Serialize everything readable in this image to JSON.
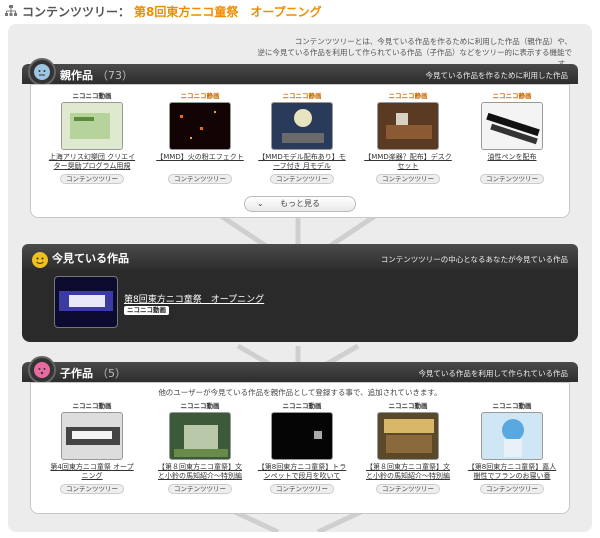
{
  "header": {
    "title_lead": "コンテンツツリー：",
    "title_name": "第8回東方ニコ童祭　オープニング"
  },
  "intro": {
    "line1": "コンテンツツリーとは、今見ている作品を作るために利用した作品（親作品）や、",
    "line2": "逆に今見ている作品を利用して作られている作品（子作品）などをツリー的に表示する機能です。"
  },
  "colors": {
    "accent": "#f08c00",
    "section_bar": "#333333",
    "panel": "#ececec"
  },
  "parents": {
    "label": "親作品",
    "count": "（73）",
    "desc": "今見ている作品を作るために利用した作品",
    "items": [
      {
        "site": "ニコニコ動画",
        "title": "上海アリス幻樂団 クリエイター奨励プログラム用規",
        "tree_label": "コンテンツツリー"
      },
      {
        "site": "ニコニコ静画",
        "title": "【MMD】火の粉エフェクト",
        "tree_label": "コンテンツツリー"
      },
      {
        "site": "ニコニコ静画",
        "title": "【MMDモデル配布あり】モーフ付き 月モデル",
        "tree_label": "コンテンツツリー"
      },
      {
        "site": "ニコニコ静画",
        "title": "【MMD楽器？配布】デスクセット",
        "tree_label": "コンテンツツリー"
      },
      {
        "site": "ニコニコ静画",
        "title": "油性ペンを配布",
        "tree_label": "コンテンツツリー"
      }
    ],
    "more_label": "もっと見る"
  },
  "current": {
    "label": "今見ている作品",
    "desc": "コンテンツツリーの中心となるあなたが今見ている作品",
    "title": "第8回東方ニコ童祭　オープニング",
    "site": "ニコニコ動画"
  },
  "children": {
    "label": "子作品",
    "count": "（5）",
    "desc": "今見ている作品を利用して作られている作品",
    "note": "他のユーザーが今見ている作品を親作品として登録する事で、追加されていきます。",
    "items": [
      {
        "site": "ニコニコ動画",
        "title": "第4回東方ニコ童祭 オープニング",
        "tree_label": "コンテンツツリー"
      },
      {
        "site": "ニコニコ動画",
        "title": "【第８回東方ニコ童祭】文と小鈴の馬知紹介～特別編",
        "tree_label": "コンテンツツリー"
      },
      {
        "site": "ニコニコ動画",
        "title": "【第8回東方ニコ童祭】トランペットで段月を吹いて",
        "tree_label": "コンテンツツリー"
      },
      {
        "site": "ニコニコ動画",
        "title": "【第８回東方ニコ童祭】文と小鈴の馬知紹介～特別編",
        "tree_label": "コンテンツツリー"
      },
      {
        "site": "ニコニコ動画",
        "title": "【第8回東方ニコ童祭】嘉人樹性でフランのお寝い番",
        "tree_label": "コンテンツツリー"
      }
    ]
  }
}
